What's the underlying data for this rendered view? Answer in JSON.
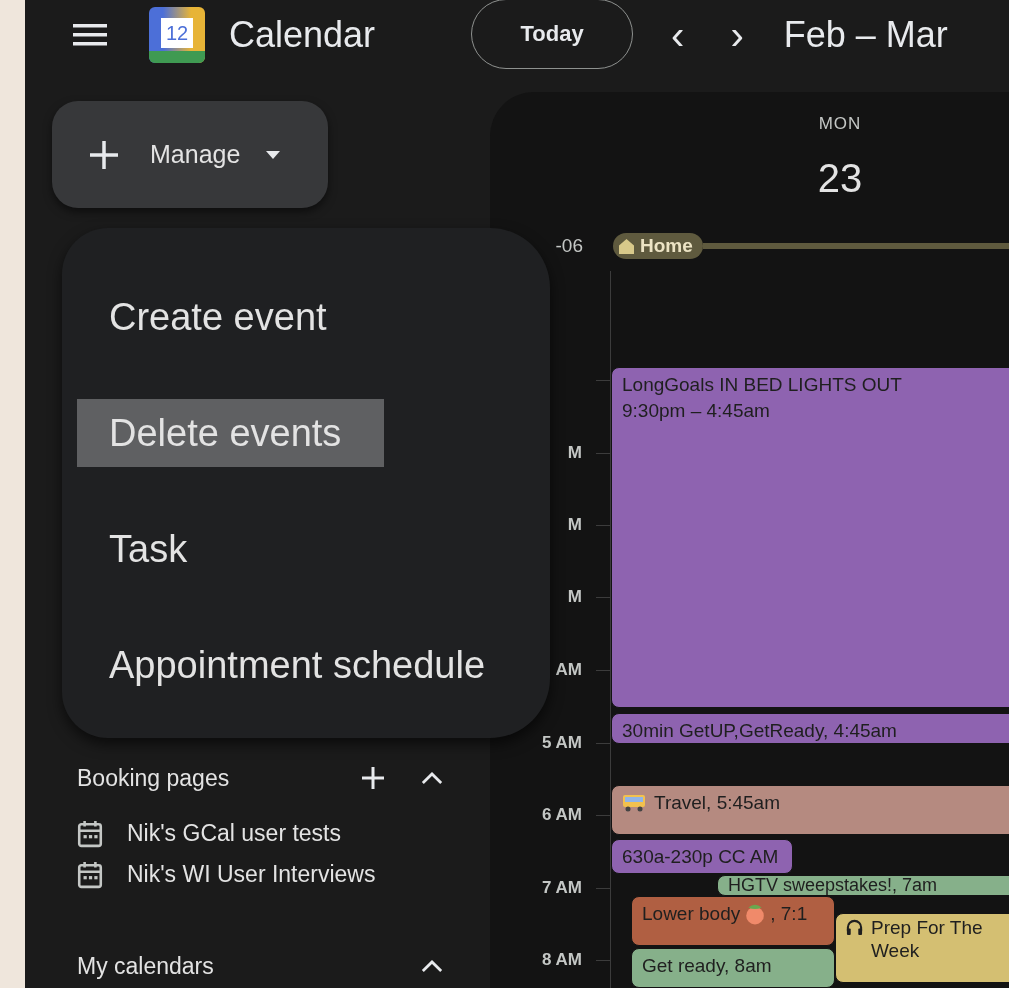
{
  "header": {
    "app_name": "Calendar",
    "logo_day": "12",
    "today_button": "Today",
    "prev": "‹",
    "next": "›",
    "range": "Feb – Mar"
  },
  "create_button": {
    "label": "Manage"
  },
  "menu": {
    "items": [
      {
        "label": "Create event",
        "selected": false
      },
      {
        "label": "Delete events",
        "selected": true
      },
      {
        "label": "Task",
        "selected": false
      },
      {
        "label": "Appointment schedule",
        "selected": false
      }
    ]
  },
  "booking_pages": {
    "title": "Booking pages",
    "expanded": true,
    "items": [
      "Nik's GCal user tests",
      "Nik's WI User Interviews"
    ]
  },
  "my_calendars": {
    "title": "My calendars",
    "expanded": true
  },
  "day": {
    "weekday": "MON",
    "date": "23"
  },
  "timezone": "-06",
  "all_day": {
    "label": "Home",
    "color": "#5f5a3e"
  },
  "hours": [
    "M",
    "M",
    "M",
    "AM",
    "5 AM",
    "6 AM",
    "7 AM",
    "8 AM"
  ],
  "events": [
    {
      "title": "LongGoals IN BED LIGHTS OUT",
      "time": "9:30pm – 4:45am",
      "color": "#8e63b0"
    },
    {
      "title": "30min GetUP,GetReady, 4:45am",
      "color": "#8e63b0"
    },
    {
      "title": "Travel, 5:45am",
      "color": "#b58a80"
    },
    {
      "title": "630a-230p CC AM",
      "color": "#8e63b0"
    },
    {
      "title": "HGTV sweepstakes!, 7am",
      "color": "#86b08a"
    },
    {
      "title": "Lower body",
      "after": ", 7:1",
      "color": "#b05f42"
    },
    {
      "title": "Get ready, 8am",
      "color": "#86b08a"
    },
    {
      "title": "Prep For The Week",
      "color": "#d4bf72"
    }
  ]
}
